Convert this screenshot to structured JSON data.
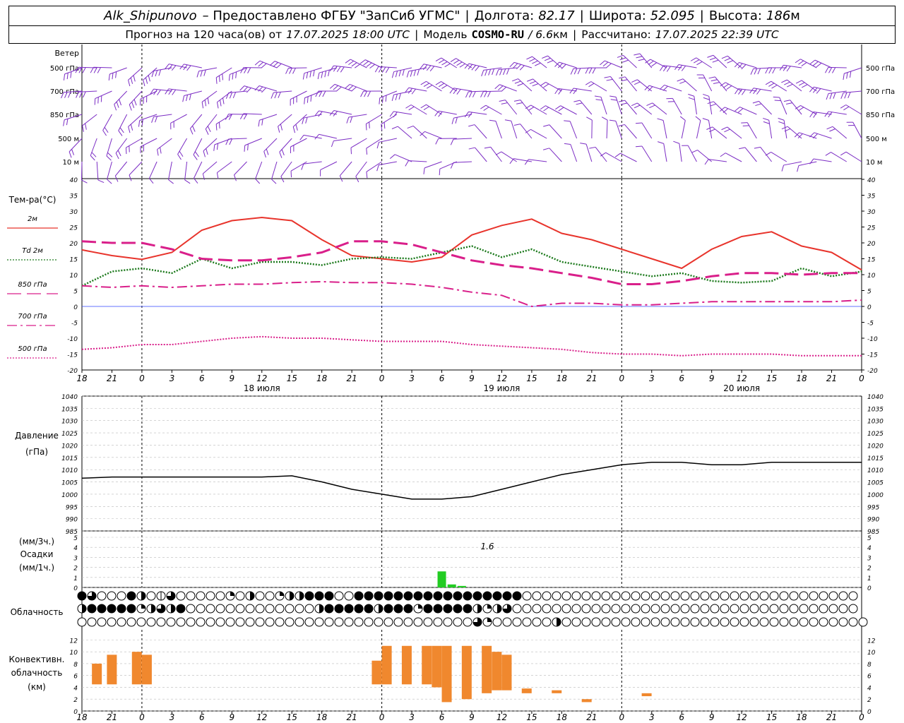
{
  "header": {
    "station": "Alk_Shipunovo",
    "provider": "– Предоставлено ФГБУ \"ЗапСиб УГМС\"",
    "lon_label": "Долгота:",
    "lon_value": "82.17",
    "lat_label": "Широта:",
    "lat_value": "52.095",
    "alt_label": "Высота:",
    "alt_value": "186",
    "alt_unit": "м",
    "forecast_prefix": "Прогноз на 120 часа(ов) от",
    "forecast_time": "17.07.2025 18:00 UTC",
    "model_label": "Модель",
    "model_name": "COSMO-RU",
    "model_res": "/ 6.6",
    "model_res_unit": "км",
    "calc_label": "Рассчитано:",
    "calc_time": "17.07.2025 22:39 UTC"
  },
  "colors": {
    "t2m": "#e8342c",
    "td2m": "#1d7a1d",
    "t850": "#d91f8a",
    "t700": "#d91f8a",
    "t500": "#d91f8a",
    "wind": "#7b2cc4",
    "precip": "#22cc22",
    "conv": "#f0882e",
    "zero": "#3344ff"
  },
  "panels": {
    "wind": {
      "title": "Ветер",
      "levels": [
        "500 гПа",
        "700 гПа",
        "850 гПа",
        "500 м",
        "10 м"
      ]
    },
    "temp": {
      "title": "Тем-ра(°C)",
      "ticks": [
        "40",
        "35",
        "30",
        "25",
        "20",
        "15",
        "10",
        "5",
        "0",
        "-5",
        "-10",
        "-15",
        "-20"
      ],
      "legend": [
        "2м",
        "Td  2м",
        "850 гПа",
        "700 гПа",
        "500 гПа"
      ]
    },
    "pres": {
      "title1": "Давление",
      "title2": "(гПа)",
      "ticks": [
        "1040",
        "1035",
        "1030",
        "1025",
        "1020",
        "1015",
        "1010",
        "1005",
        "1000",
        "995",
        "990",
        "985"
      ]
    },
    "precip": {
      "unit1": "(мм/3ч.)",
      "title": "Осадки",
      "unit2": "(мм/1ч.)",
      "ticks": [
        "5",
        "4",
        "3",
        "2",
        "1",
        "0"
      ],
      "max_label": "1.6"
    },
    "cloud": {
      "title": "Облачность"
    },
    "conv": {
      "title1": "Конвективн.",
      "title2": "облачность",
      "title3": "(км)",
      "ticks": [
        "12",
        "10",
        "8",
        "6",
        "4",
        "2",
        "0"
      ]
    }
  },
  "time_axis": {
    "hour_labels": [
      "18",
      "21",
      "0",
      "3",
      "6",
      "9",
      "12",
      "15",
      "18",
      "21",
      "0",
      "3",
      "6",
      "9",
      "12",
      "15",
      "18",
      "21",
      "0",
      "3",
      "6",
      "9",
      "12",
      "15",
      "18",
      "21",
      "0"
    ],
    "day_labels": [
      {
        "hour": 18,
        "label": "18 июля"
      },
      {
        "hour": 42,
        "label": "19 июля"
      },
      {
        "hour": 66,
        "label": "20 июля"
      }
    ]
  },
  "chart_data": [
    {
      "type": "line",
      "title": "Тем-ра(°C)",
      "ylim": [
        -20,
        40
      ],
      "x_hours_from_start": [
        0,
        3,
        6,
        9,
        12,
        15,
        18,
        21,
        24,
        27,
        30,
        33,
        36,
        39,
        42,
        45,
        48,
        51,
        54,
        57,
        60,
        63,
        66,
        69,
        72,
        75,
        78
      ],
      "series": [
        {
          "name": "2м",
          "values": [
            17.8,
            16,
            14.8,
            17,
            24,
            27,
            28,
            27,
            21,
            16,
            15,
            14,
            15.5,
            22.5,
            25.5,
            27.5,
            23,
            21,
            18,
            15,
            12,
            18,
            22,
            23.5,
            19,
            17,
            11.5
          ]
        },
        {
          "name": "Td  2м",
          "values": [
            6.5,
            11,
            12,
            10.5,
            15,
            12,
            14,
            14,
            13,
            15,
            15.5,
            15,
            17,
            19,
            15.5,
            18,
            14,
            12.5,
            11,
            9.5,
            10.5,
            8,
            7.5,
            8,
            12,
            9.5,
            11
          ]
        },
        {
          "name": "850 гПа",
          "values": [
            20.5,
            20,
            20,
            18,
            15,
            14.5,
            14.5,
            15.5,
            17,
            20.5,
            20.5,
            19.5,
            17,
            14.5,
            13,
            12,
            10.5,
            9,
            7,
            7,
            8,
            9.5,
            10.5,
            10.5,
            10,
            10.5,
            10.5
          ]
        },
        {
          "name": "700 гПа",
          "values": [
            6.5,
            6,
            6.5,
            6,
            6.5,
            7,
            7,
            7.5,
            7.8,
            7.5,
            7.5,
            7,
            6,
            4.5,
            3.5,
            0,
            1,
            1,
            0.5,
            0.5,
            1,
            1.5,
            1.5,
            1.5,
            1.5,
            1.5,
            2
          ]
        },
        {
          "name": "500 гПа",
          "values": [
            -13.5,
            -13,
            -12,
            -12,
            -11,
            -10,
            -9.5,
            -10,
            -10,
            -10.5,
            -11,
            -11,
            -11,
            -12,
            -12.5,
            -13,
            -13.5,
            -14.5,
            -15,
            -15,
            -15.5,
            -15,
            -15,
            -15,
            -15.5,
            -15.5,
            -15.5
          ]
        }
      ]
    },
    {
      "type": "line",
      "title": "Давление",
      "ylabel": "(гПа)",
      "ylim": [
        985,
        1040
      ],
      "x_hours_from_start": [
        0,
        3,
        6,
        9,
        12,
        15,
        18,
        21,
        24,
        27,
        30,
        33,
        36,
        39,
        42,
        45,
        48,
        51,
        54,
        57,
        60,
        63,
        66,
        69,
        72,
        75,
        78
      ],
      "series": [
        {
          "name": "",
          "values": [
            1006.5,
            1007,
            1007,
            1007,
            1007,
            1007,
            1007,
            1007.5,
            1005,
            1002,
            1000,
            998,
            998,
            999,
            1002,
            1005,
            1008,
            1010,
            1012,
            1013,
            1013,
            1012,
            1012,
            1013,
            1013,
            1013,
            1013
          ]
        }
      ]
    },
    {
      "type": "bar",
      "title": "Осадки",
      "ylim": [
        0,
        5
      ],
      "points": [
        {
          "hour": 9,
          "value": 1.6
        },
        {
          "hour": 10,
          "value": 0.3
        },
        {
          "hour": 11,
          "value": 0.15
        }
      ]
    },
    {
      "type": "bar",
      "title": "Конвективн. облачность",
      "ylabel": "(км)",
      "ylim": [
        0,
        12
      ],
      "segments": [
        {
          "hour": -1.0,
          "bottom": 4.5,
          "top": 8
        },
        {
          "hour": 0.5,
          "bottom": 4.5,
          "top": 9.5
        },
        {
          "hour": 3.0,
          "bottom": 4.5,
          "top": 10
        },
        {
          "hour": 4.0,
          "bottom": 4.5,
          "top": 9.5
        },
        {
          "hour": 27.0,
          "bottom": 4.5,
          "top": 8.5
        },
        {
          "hour": 28.0,
          "bottom": 4.5,
          "top": 11
        },
        {
          "hour": 30.0,
          "bottom": 4.5,
          "top": 11
        },
        {
          "hour": 32.0,
          "bottom": 4.5,
          "top": 11
        },
        {
          "hour": 33.0,
          "bottom": 4.0,
          "top": 11
        },
        {
          "hour": 34.0,
          "bottom": 1.5,
          "top": 11
        },
        {
          "hour": 36.0,
          "bottom": 2.0,
          "top": 11
        },
        {
          "hour": 38.0,
          "bottom": 3.0,
          "top": 11
        },
        {
          "hour": 39.0,
          "bottom": 3.5,
          "top": 10
        },
        {
          "hour": 40.0,
          "bottom": 3.5,
          "top": 9.5
        },
        {
          "hour": 42.0,
          "bottom": 3.0,
          "top": 3.8
        },
        {
          "hour": 45.0,
          "bottom": 3.0,
          "top": 3.5
        },
        {
          "hour": 48.0,
          "bottom": 1.5,
          "top": 2.0
        },
        {
          "hour": 54.0,
          "bottom": 2.5,
          "top": 3.0
        }
      ]
    }
  ],
  "cloud_rows": {
    "high": "FWEEEFHEOWEEEEEQEHEEQHHFFFEEFFFFFFFFFFFFFFFFFEEEEEEEEEEEEEEEEEEEEEEEEEEEEEEEEEE",
    "mid": "HFFFFFQHWHFEEEEEEEEEEEEEHFFFFFHFFFQFFFFFHQHWEEEEEEEEEEEEEEEEEEEEEEEEEEEEEEEEEEE",
    "low": "EEEEEEEEEEEEEEEEEEEEEEEEEEEEEEEEEEEEEEEEWQEEEEEEHEEEEEEEEEEEEEEEEEEEEEEEEEEEEEEE"
  }
}
